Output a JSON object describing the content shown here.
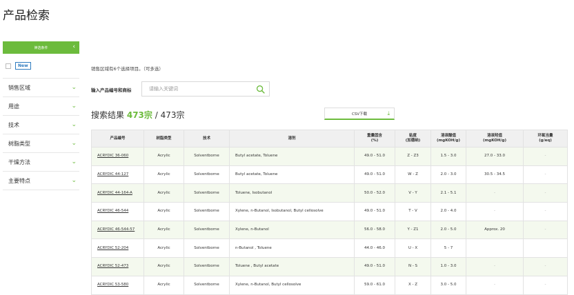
{
  "page": {
    "title": "产品检索"
  },
  "sidebar": {
    "header_label": "筛选条件",
    "new_badge": "New",
    "items": [
      {
        "label": "销售区域"
      },
      {
        "label": "用途"
      },
      {
        "label": "技术"
      },
      {
        "label": "树脂类型"
      },
      {
        "label": "干燥方法"
      },
      {
        "label": "主要特点"
      }
    ]
  },
  "filters": {
    "hint": "销售区域有6个选择项目。（可多选）",
    "search_label": "输入产品编号和商标",
    "search_placeholder": "请输入关键词"
  },
  "results": {
    "label": "搜索结果",
    "count": "473宗",
    "total": "/ 473宗",
    "csv_label": "CSV下载"
  },
  "table": {
    "headers": [
      "产品编号",
      "树脂类型",
      "技术",
      "溶剂",
      "重量固含\n(%)",
      "粘度\n(加德纳)",
      "溶液酸值\n(mgKOH/g)",
      "溶液羟值\n(mgKOH/g)",
      "环氧当量\n(g/eq)"
    ],
    "rows": [
      {
        "code": "ACRYDIC 36-060",
        "resin": "Acrylic",
        "tech": "Solventborne",
        "solvent": "Butyl acetate, Toluene",
        "solids": "49.0 - 51.0",
        "viscosity": "Z - Z3",
        "acid": "1.5 - 3.0",
        "hydroxyl": "27.0 - 33.0",
        "epoxy": "-"
      },
      {
        "code": "ACRYDIC 44-127",
        "resin": "Acrylic",
        "tech": "Solventborne",
        "solvent": "Butyl acetate, Toluene",
        "solids": "49.0 - 51.0",
        "viscosity": "W - Z",
        "acid": "2.0 - 3.0",
        "hydroxyl": "30.5 - 34.5",
        "epoxy": "-"
      },
      {
        "code": "ACRYDIC 44-164-A",
        "resin": "Acrylic",
        "tech": "Solventborne",
        "solvent": "Toluene, Isobutanol",
        "solids": "50.0 - 52.0",
        "viscosity": "V - Y",
        "acid": "2.1 - 5.1",
        "hydroxyl": "-",
        "epoxy": "-"
      },
      {
        "code": "ACRYDIC 46-544",
        "resin": "Acrylic",
        "tech": "Solventborne",
        "solvent": "Xylene, n-Butanol, Isobutanol, Butyl cellosolve",
        "solids": "49.0 - 51.0",
        "viscosity": "T - V",
        "acid": "2.0 - 4.0",
        "hydroxyl": "-",
        "epoxy": "-"
      },
      {
        "code": "ACRYDIC 46-544-57",
        "resin": "Acrylic",
        "tech": "Solventborne",
        "solvent": "Xylene, n-Butanol",
        "solids": "56.0 - 58.0",
        "viscosity": "Y - Z1",
        "acid": "2.0 - 5.0",
        "hydroxyl": "Approx. 20",
        "epoxy": "-"
      },
      {
        "code": "ACRYDIC 52-204",
        "resin": "Acrylic",
        "tech": "Solventborne",
        "solvent": "n-Butanol , Toluene",
        "solids": "44.0 - 46.0",
        "viscosity": "U - X",
        "acid": "5 - 7",
        "hydroxyl": "",
        "epoxy": ""
      },
      {
        "code": "ACRYDIC 52-473",
        "resin": "Acrylic",
        "tech": "Solventborne",
        "solvent": "Toluene , Butyl acetate",
        "solids": "49.0 - 51.0",
        "viscosity": "N - S",
        "acid": "1.0 - 3.0",
        "hydroxyl": "-",
        "epoxy": "-"
      },
      {
        "code": "ACRYDIC 53-580",
        "resin": "Acrylic",
        "tech": "Solventborne",
        "solvent": "Xylene, n-Butanol, Butyl cellosolve",
        "solids": "59.0 - 61.0",
        "viscosity": "X - Z",
        "acid": "3.0 - 5.0",
        "hydroxyl": "-",
        "epoxy": "-"
      }
    ]
  },
  "colors": {
    "accent": "#6cbb3c",
    "row_alt": "#f4f9ee",
    "header_bg": "#f0f0f0"
  }
}
